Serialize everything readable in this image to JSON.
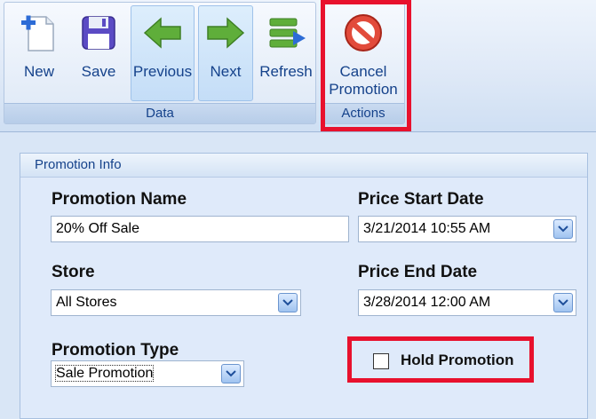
{
  "ribbon": {
    "buttons": {
      "new": "New",
      "save": "Save",
      "previous": "Previous",
      "next": "Next",
      "refresh": "Refresh",
      "cancel_promotion_line1": "Cancel",
      "cancel_promotion_line2": "Promotion"
    },
    "groups": {
      "data": "Data",
      "actions": "Actions"
    }
  },
  "panel": {
    "title": "Promotion Info",
    "promotion_name": {
      "label": "Promotion Name",
      "value": "20% Off Sale"
    },
    "store": {
      "label": "Store",
      "value": "All Stores"
    },
    "promotion_type": {
      "label": "Promotion Type",
      "value": "Sale Promotion"
    },
    "price_start_date": {
      "label": "Price Start Date",
      "value": "3/21/2014 10:55 AM"
    },
    "price_end_date": {
      "label": "Price End Date",
      "value": "3/28/2014 12:00 AM"
    },
    "hold_promotion": {
      "label": "Hold Promotion",
      "checked": false
    }
  },
  "icons": {
    "new": "new-document-icon",
    "save": "floppy-disk-icon",
    "previous": "green-arrow-left-icon",
    "next": "green-arrow-right-icon",
    "refresh": "refresh-icon",
    "cancel": "cancel-circle-icon",
    "dropdown": "chevron-down-icon"
  },
  "colors": {
    "highlight": "#e8112d",
    "ribbon_text": "#15428b",
    "accent_green": "#5fae3a"
  }
}
